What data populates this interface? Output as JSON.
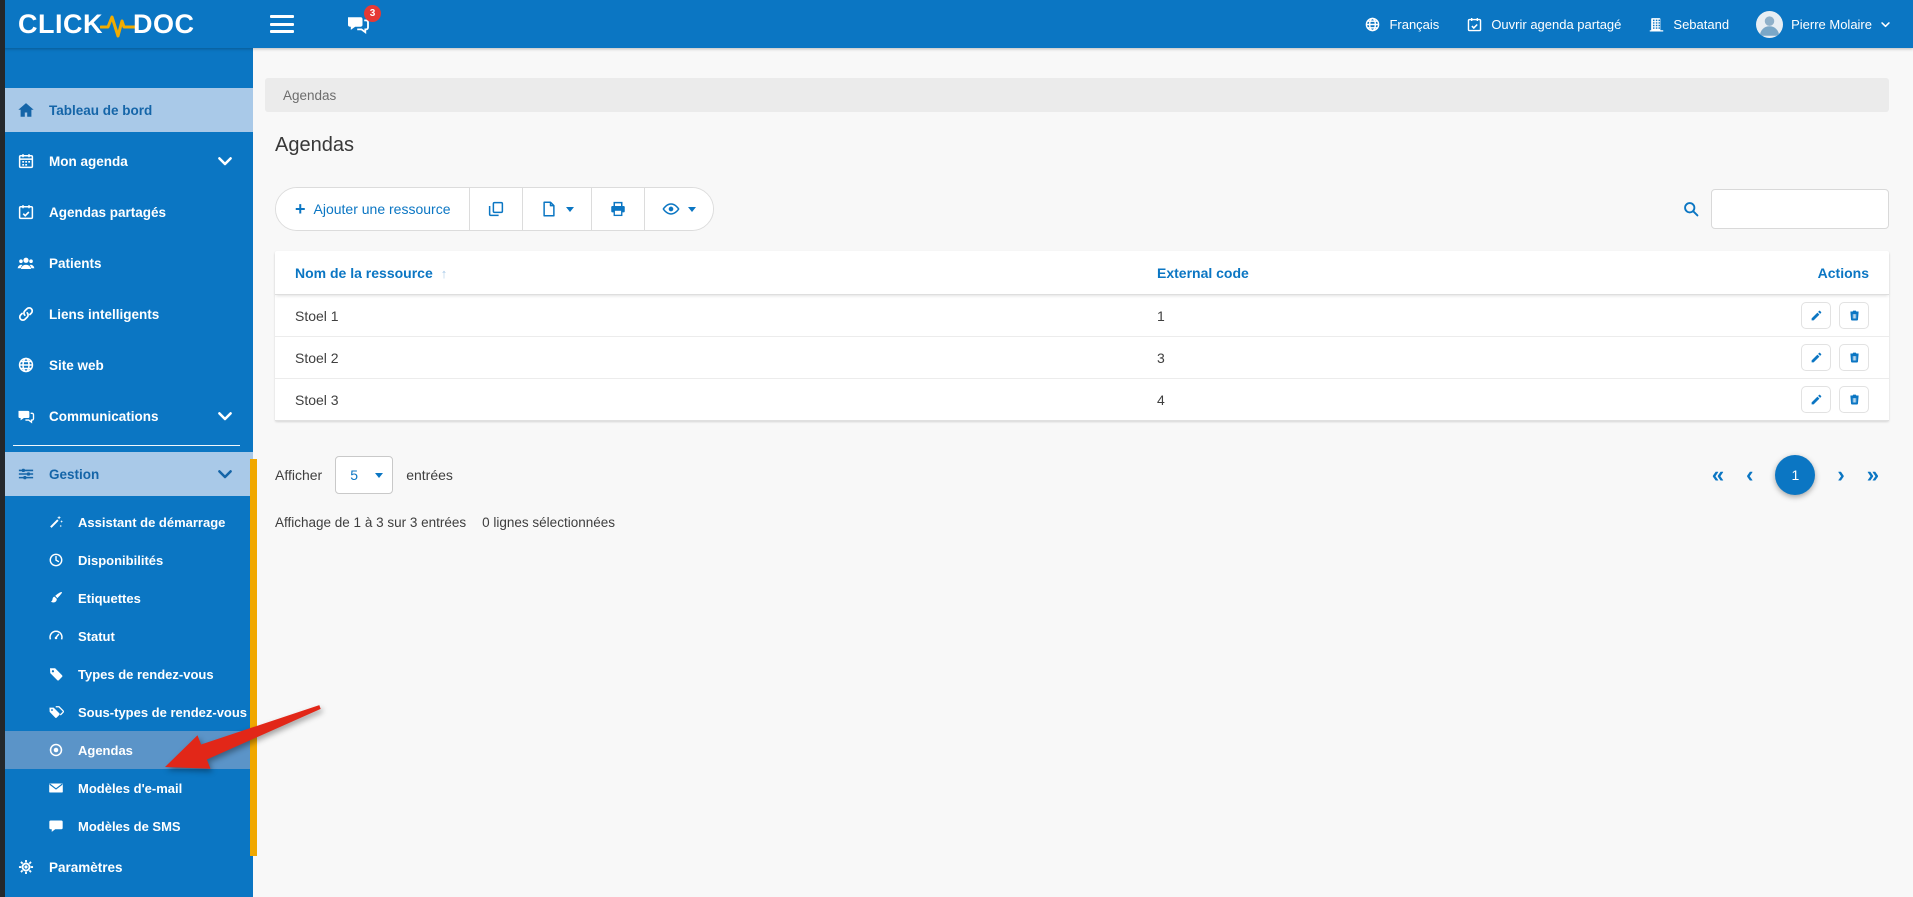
{
  "topbar": {
    "logo_left": "CLICK",
    "logo_right": "DOC",
    "chat_badge": "3",
    "language": "Français",
    "shared_agenda": "Ouvrir agenda partagé",
    "organization": "Sebatand",
    "user_name": "Pierre Molaire"
  },
  "sidebar": {
    "items": [
      {
        "label": "Tableau de bord",
        "icon": "home-icon",
        "state": "selected"
      },
      {
        "label": "Mon agenda",
        "icon": "calendar-icon",
        "chevron": true
      },
      {
        "label": "Agendas partagés",
        "icon": "calendar-check-icon"
      },
      {
        "label": "Patients",
        "icon": "patients-icon"
      },
      {
        "label": "Liens intelligents",
        "icon": "link-icon"
      },
      {
        "label": "Site web",
        "icon": "globe-icon"
      },
      {
        "label": "Communications",
        "icon": "comments-icon",
        "chevron": true
      },
      {
        "divider": true
      },
      {
        "label": "Gestion",
        "icon": "sliders-icon",
        "chevron": true,
        "state": "selected",
        "expanded": true
      },
      {
        "label": "Paramètres",
        "icon": "gear-icon"
      }
    ],
    "gestion_children": [
      {
        "label": "Assistant de démarrage",
        "icon": "wand-icon"
      },
      {
        "label": "Disponibilités",
        "icon": "clock-icon"
      },
      {
        "label": "Etiquettes",
        "icon": "brush-icon"
      },
      {
        "label": "Statut",
        "icon": "gauge-icon"
      },
      {
        "label": "Types de rendez-vous",
        "icon": "tag-icon"
      },
      {
        "label": "Sous-types de rendez-vous",
        "icon": "tags-icon"
      },
      {
        "label": "Agendas",
        "icon": "bullseye-icon",
        "state": "selected",
        "annotated": true
      },
      {
        "label": "Modèles d'e-mail",
        "icon": "envelope-icon"
      },
      {
        "label": "Modèles de SMS",
        "icon": "comment-icon"
      }
    ]
  },
  "main": {
    "breadcrumb": "Agendas",
    "title": "Agendas",
    "toolbar": {
      "add_label": "Ajouter une ressource",
      "icons": [
        "copy-icon",
        "file-icon",
        "printer-icon",
        "eye-icon"
      ]
    },
    "search": {
      "value": ""
    },
    "table": {
      "columns": [
        "Nom de la ressource",
        "External code",
        "Actions"
      ],
      "sorted_column": "Nom de la ressource",
      "sort_direction": "asc",
      "rows": [
        {
          "name": "Stoel 1",
          "code": "1"
        },
        {
          "name": "Stoel 2",
          "code": "3"
        },
        {
          "name": "Stoel 3",
          "code": "4"
        }
      ]
    },
    "pagination": {
      "show_label": "Afficher",
      "page_size": "5",
      "entries_label": "entrées",
      "current_page": "1",
      "info": "Affichage de 1 à 3 sur 3 entrées",
      "selection_info": "0 lignes sélectionnées"
    }
  },
  "colors": {
    "brand_blue": "#0b76c3",
    "selected_light_blue": "#a9c9e8",
    "selected_sub_blue": "#5b94c8",
    "accent_yellow": "#f0a800",
    "alert_red": "#e53935",
    "arrow_red": "#e22718"
  }
}
